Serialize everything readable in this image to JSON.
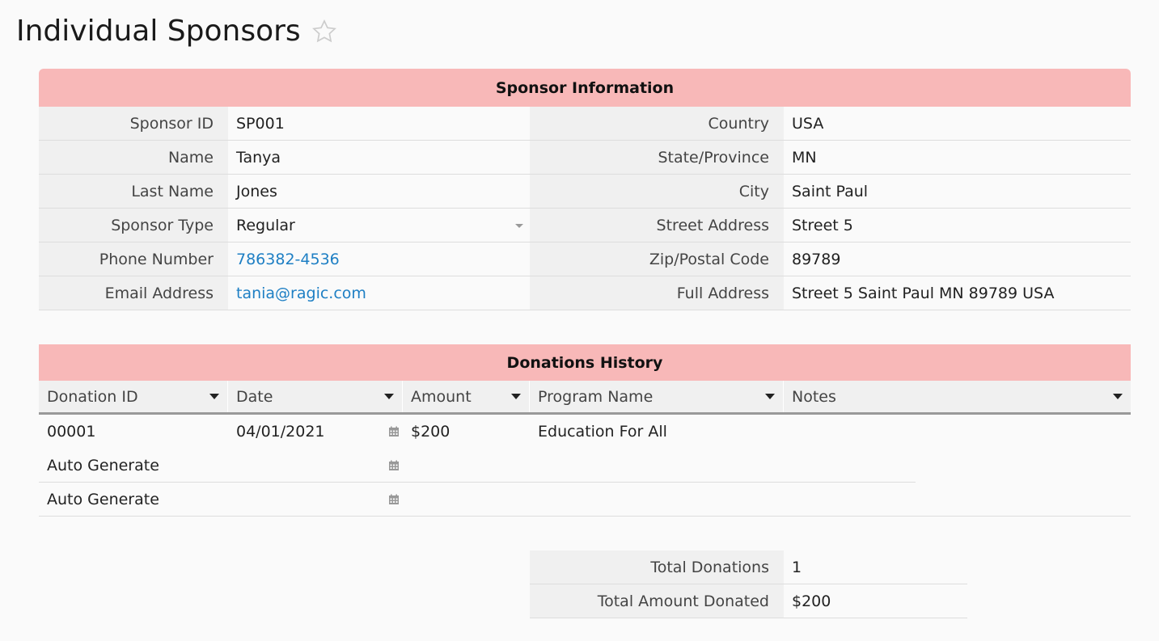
{
  "page": {
    "title": "Individual Sponsors"
  },
  "colors": {
    "section_header": "#f8b8b8",
    "link": "#1e7fc4"
  },
  "sponsor_info": {
    "header": "Sponsor Information",
    "left": [
      {
        "label": "Sponsor ID",
        "value": "SP001"
      },
      {
        "label": "Name",
        "value": "Tanya"
      },
      {
        "label": "Last Name",
        "value": "Jones"
      },
      {
        "label": "Sponsor Type",
        "value": "Regular"
      },
      {
        "label": "Phone Number",
        "value": "786382-4536"
      },
      {
        "label": "Email Address",
        "value": "tania@ragic.com"
      }
    ],
    "right": [
      {
        "label": "Country",
        "value": "USA"
      },
      {
        "label": "State/Province",
        "value": "MN"
      },
      {
        "label": "City",
        "value": "Saint Paul"
      },
      {
        "label": "Street Address",
        "value": "Street 5"
      },
      {
        "label": "Zip/Postal Code",
        "value": "89789"
      },
      {
        "label": "Full Address",
        "value": "Street 5 Saint Paul MN 89789 USA"
      }
    ]
  },
  "donations": {
    "header": "Donations History",
    "columns": [
      "Donation ID",
      "Date",
      "Amount",
      "Program Name",
      "Notes"
    ],
    "rows": [
      [
        "00001",
        "04/01/2021",
        "$200",
        "Education For All",
        ""
      ],
      [
        "Auto Generate",
        "",
        "",
        "",
        ""
      ],
      [
        "Auto Generate",
        "",
        "",
        "",
        ""
      ]
    ]
  },
  "totals": [
    {
      "label": "Total Donations",
      "value": "1"
    },
    {
      "label": "Total Amount Donated",
      "value": "$200"
    }
  ]
}
